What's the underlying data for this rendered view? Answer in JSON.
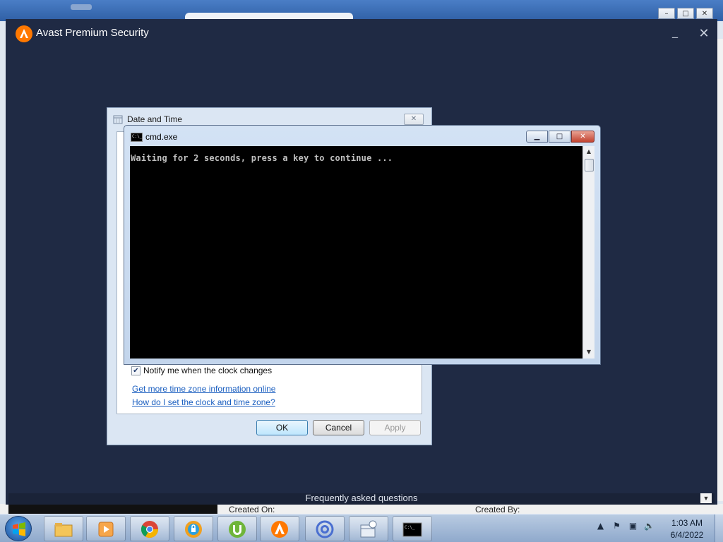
{
  "avast": {
    "title": "Avast Premium Security",
    "footer_text": "Frequently asked questions"
  },
  "background": {
    "col_created_on": "Created On:",
    "col_created_by": "Created By:"
  },
  "date_time_dialog": {
    "title": "Date and Time",
    "notify_label": "Notify me when the clock changes",
    "notify_checked": true,
    "link_timezone": "Get more time zone information online",
    "link_howto": "How do I set the clock and time zone?",
    "ok_label": "OK",
    "cancel_label": "Cancel",
    "apply_label": "Apply"
  },
  "cmd": {
    "title": "cmd.exe",
    "output": "Waiting for 2 seconds, press a key to continue ..."
  },
  "taskbar": {
    "apps": [
      "windows-explorer",
      "media-player",
      "chrome",
      "browser-secure",
      "utorrent",
      "avast",
      "email",
      "calendar",
      "cmd"
    ],
    "time": "1:03 AM",
    "date": "6/4/2022"
  },
  "colors": {
    "avast_bg": "#1f2a44",
    "avast_orange": "#ff7800",
    "link_blue": "#1b5fc0",
    "taskbar": "#a9bedb"
  }
}
